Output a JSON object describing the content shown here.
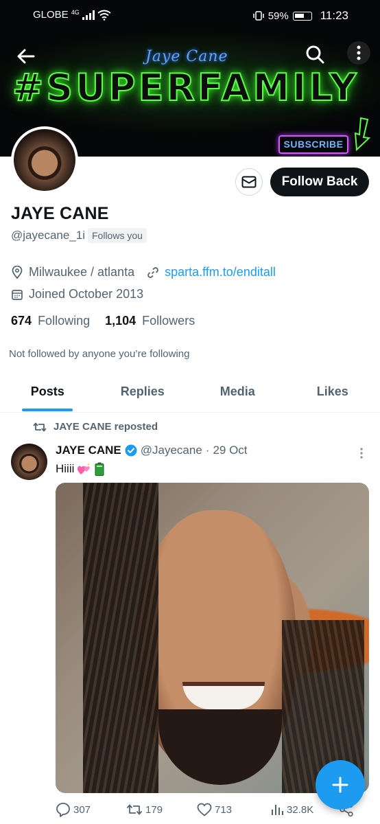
{
  "status_bar": {
    "carrier": "GLOBE",
    "network": "4G",
    "battery": "59%",
    "time": "11:23"
  },
  "banner": {
    "script_text": "Jaye Cane",
    "neon_text": "#SUPERFAMILY",
    "subscribe_text": "SUBSCRIBE"
  },
  "profile": {
    "display_name": "JAYE CANE",
    "handle": "@jayecane_1i",
    "follows_you": "Follows you",
    "location": "Milwaukee / atlanta",
    "website": "sparta.ffm.to/enditall",
    "joined": "Joined October 2013",
    "following_count": "674",
    "following_label": "Following",
    "followers_count": "1,104",
    "followers_label": "Followers",
    "not_followed": "Not followed by anyone you’re following",
    "follow_button": "Follow Back"
  },
  "tabs": [
    {
      "label": "Posts",
      "active": true
    },
    {
      "label": "Replies",
      "active": false
    },
    {
      "label": "Media",
      "active": false
    },
    {
      "label": "Likes",
      "active": false
    }
  ],
  "post": {
    "repost_label": "JAYE CANE reposted",
    "author": "JAYE CANE",
    "handle": "@Jayecane",
    "separator": "·",
    "date": "29 Oct",
    "text": "Hiiii",
    "emojis": [
      "heart-sparkle",
      "battery"
    ],
    "replies": "307",
    "reposts": "179",
    "likes": "713",
    "views": "32.8K"
  },
  "colors": {
    "accent": "#1d9bf0",
    "text": "#0f1419",
    "secondary": "#536471",
    "neon_green": "#5dff4a"
  }
}
